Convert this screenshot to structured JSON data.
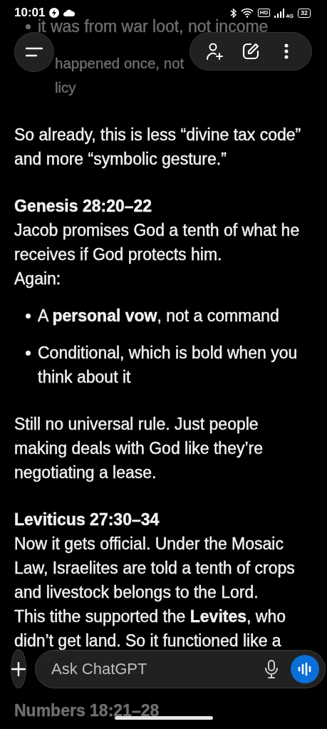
{
  "status_bar": {
    "time": "10:01",
    "hd": "HD",
    "network": "4G",
    "battery": "32"
  },
  "composer": {
    "placeholder": "Ask ChatGPT"
  },
  "sections": [
    {
      "faded": true,
      "bullets": [
        {
          "lines": [
            "it was from war loot, not income"
          ]
        },
        {
          "marker": false,
          "lines": [
            "happened once, not",
            "licy"
          ]
        }
      ]
    },
    {
      "faded": false,
      "lines": [
        "So already, this is less “divine tax code” and more “symbolic gesture.”"
      ]
    },
    {
      "faded": false,
      "heading": "Genesis 28:20–22",
      "lines": [
        "Jacob promises God a tenth of what he receives if God protects him.",
        "Again:"
      ],
      "bullets": [
        {
          "lines": [
            "A **personal vow**, not a command"
          ]
        },
        {
          "lines": [
            "Conditional, which is bold when you think about it"
          ]
        }
      ]
    },
    {
      "faded": false,
      "lines": [
        "Still no universal rule. Just people making deals with God like they’re negotiating a lease."
      ]
    },
    {
      "faded": false,
      "heading": "Leviticus 27:30–34",
      "lines": [
        "Now it gets official. Under the Mosaic Law, Israelites are told a tenth of crops and livestock belongs to the Lord.",
        "This tithe supported the **Levites**, who didn’t get land. So it functioned like a"
      ]
    },
    {
      "faded": true,
      "heading": "Numbers 18:21–28"
    }
  ]
}
